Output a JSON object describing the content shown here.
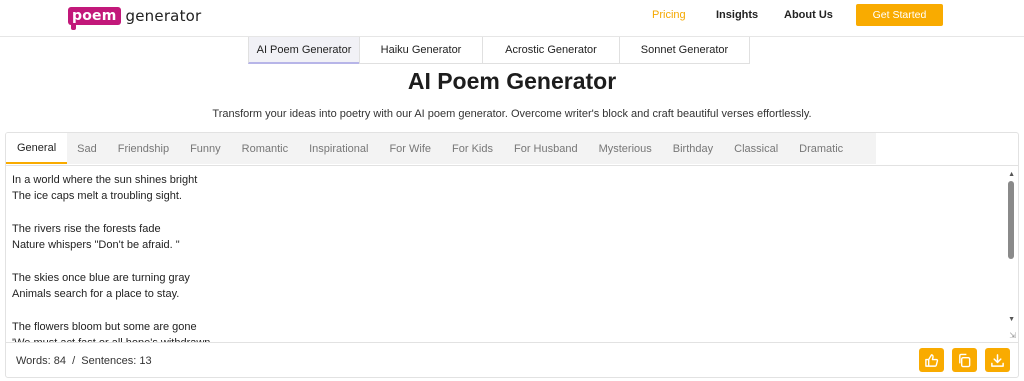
{
  "header": {
    "logo_mark": "poem",
    "logo_text": "generator",
    "nav": {
      "pricing": "Pricing",
      "insights": "Insights",
      "about": "About Us"
    },
    "cta": "Get Started"
  },
  "tool_tabs": [
    "AI Poem Generator",
    "Haiku Generator",
    "Acrostic Generator",
    "Sonnet Generator"
  ],
  "title": "AI Poem Generator",
  "subtitle": "Transform your ideas into poetry with our AI poem generator. Overcome writer's block and craft beautiful verses effortlessly.",
  "category_tabs": [
    "General",
    "Sad",
    "Friendship",
    "Funny",
    "Romantic",
    "Inspirational",
    "For Wife",
    "For Kids",
    "For Husband",
    "Mysterious",
    "Birthday",
    "Classical",
    "Dramatic"
  ],
  "poem": "In a world where the sun shines bright\nThe ice caps melt a troubling sight.\n\nThe rivers rise the forests fade\nNature whispers \"Don't be afraid. \"\n\nThe skies once blue are turning gray\nAnimals search for a place to stay.\n\nThe flowers bloom but some are gone\n'We must act fast or all hope's withdrawn.",
  "stats": {
    "words_label": "Words:",
    "words": "84",
    "sep": "/",
    "sentences_label": "Sentences:",
    "sentences": "13"
  },
  "icons": {
    "like": "thumbs-up-icon",
    "copy": "copy-icon",
    "download": "download-icon"
  },
  "colors": {
    "accent": "#f9ab00",
    "brand": "#c2187a"
  }
}
